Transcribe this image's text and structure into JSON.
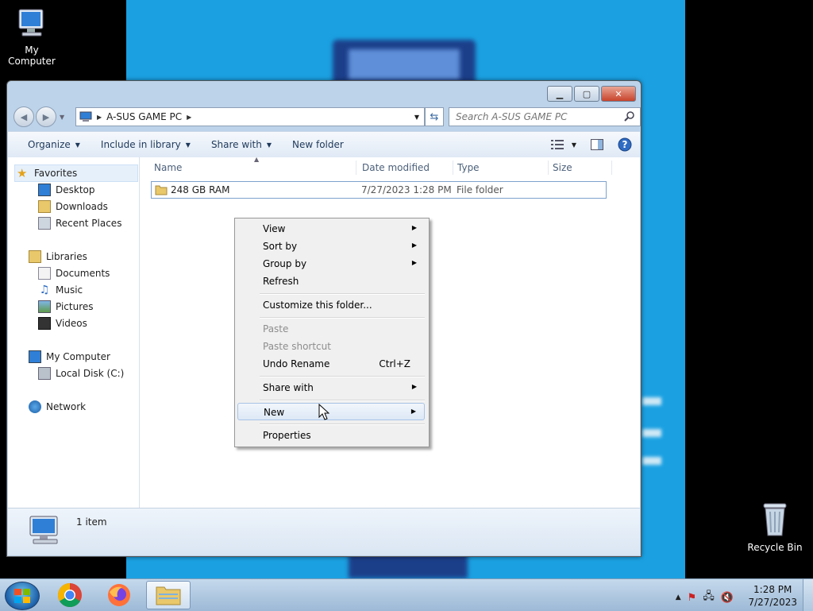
{
  "desktop": {
    "icons": [
      {
        "label": "My Computer"
      },
      {
        "label": "Recycle Bin"
      }
    ]
  },
  "window": {
    "address": {
      "root_icon": "computer-icon",
      "path": "A-SUS GAME PC"
    },
    "search": {
      "placeholder": "Search A-SUS GAME PC"
    },
    "toolbar": {
      "organize": "Organize",
      "include_in_library": "Include in library",
      "share_with": "Share with",
      "new_folder": "New folder"
    },
    "nav": {
      "favorites": "Favorites",
      "desktop": "Desktop",
      "downloads": "Downloads",
      "recent_places": "Recent Places",
      "libraries": "Libraries",
      "documents": "Documents",
      "music": "Music",
      "pictures": "Pictures",
      "videos": "Videos",
      "my_computer": "My Computer",
      "local_disk": "Local Disk (C:)",
      "network": "Network"
    },
    "columns": {
      "name": "Name",
      "date_modified": "Date modified",
      "type": "Type",
      "size": "Size"
    },
    "files": [
      {
        "name": "248 GB RAM",
        "date_modified": "7/27/2023 1:28 PM",
        "type": "File folder",
        "size": ""
      }
    ],
    "status": {
      "item_count": "1 item"
    }
  },
  "context_menu": {
    "view": "View",
    "sort_by": "Sort by",
    "group_by": "Group by",
    "refresh": "Refresh",
    "customize": "Customize this folder...",
    "paste": "Paste",
    "paste_shortcut": "Paste shortcut",
    "undo_rename": "Undo Rename",
    "undo_shortcut": "Ctrl+Z",
    "share_with": "Share with",
    "new": "New",
    "properties": "Properties",
    "highlighted_item": "New"
  },
  "taskbar": {
    "clock_time": "1:28 PM",
    "clock_date": "7/27/2023"
  }
}
